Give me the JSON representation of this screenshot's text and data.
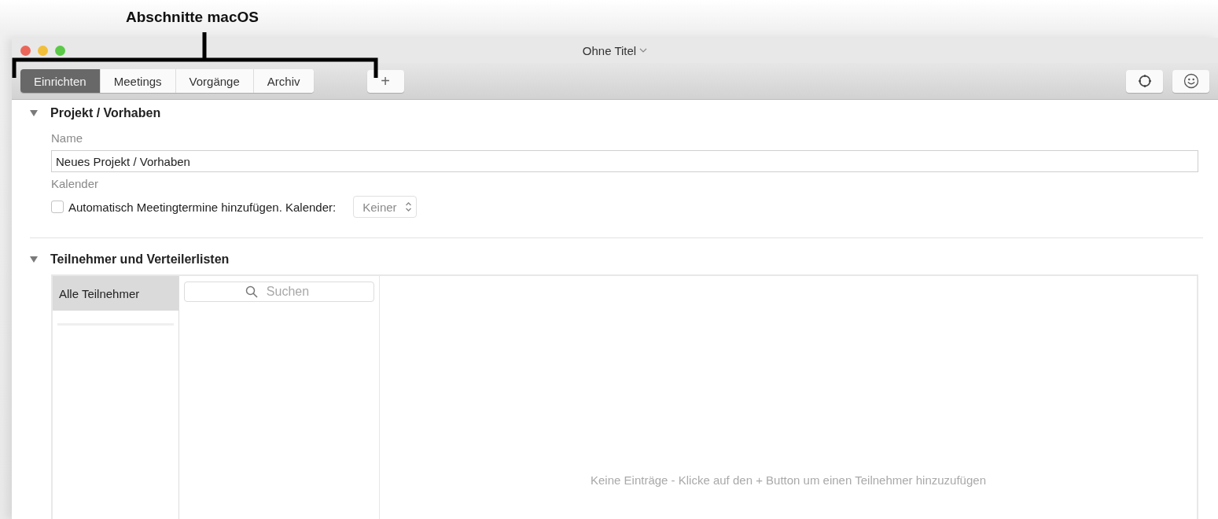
{
  "annotation": {
    "label": "Abschnitte macOS"
  },
  "window": {
    "title": "Ohne Titel"
  },
  "tabs": [
    {
      "label": "Einrichten",
      "selected": true
    },
    {
      "label": "Meetings",
      "selected": false
    },
    {
      "label": "Vorgänge",
      "selected": false
    },
    {
      "label": "Archiv",
      "selected": false
    }
  ],
  "add_button": {
    "label": "+"
  },
  "sections": [
    {
      "title": "Projekt / Vorhaben",
      "expanded": true,
      "kind": "project",
      "name_label": "Name",
      "name_value": "Neues Projekt / Vorhaben",
      "calendar_label": "Kalender",
      "auto_checkbox": {
        "label": "Automatisch Meetingtermine hinzufügen. Kalender:",
        "checked": false
      },
      "calendar_popup": {
        "value": "Keiner"
      }
    },
    {
      "title": "Teilnehmer und Verteilerlisten",
      "expanded": true,
      "kind": "participants",
      "groups": [
        {
          "label": "Alle Teilnehmer",
          "selected": true
        }
      ],
      "search": {
        "placeholder": "Suchen"
      },
      "empty_message": "Keine Einträge - Klicke auf den + Button um einen Teilnehmer hinzuzufügen"
    }
  ]
}
